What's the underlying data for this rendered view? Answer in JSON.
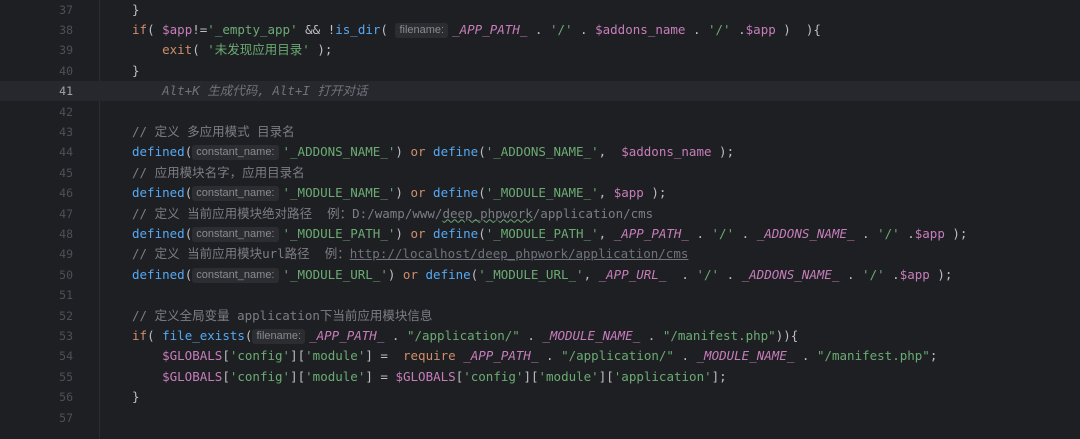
{
  "colors": {
    "background": "#1e1f22",
    "keyword": "#cf8e6d",
    "function": "#56a8f5",
    "string": "#6aab73",
    "variable": "#c77dbb",
    "comment": "#7a7e85",
    "inlay_bg": "#2b2d30"
  },
  "editor": {
    "current_line": 41,
    "lines": [
      {
        "n": "37",
        "tokens": [
          {
            "t": "}",
            "c": "p"
          }
        ]
      },
      {
        "n": "38",
        "tokens": [
          {
            "t": "if",
            "c": "kw"
          },
          {
            "t": "( ",
            "c": "p"
          },
          {
            "t": "$app",
            "c": "var"
          },
          {
            "t": "!=",
            "c": "p"
          },
          {
            "t": "'_empty_app'",
            "c": "str"
          },
          {
            "t": " && !",
            "c": "p"
          },
          {
            "t": "is_dir",
            "c": "fn"
          },
          {
            "t": "( ",
            "c": "p"
          },
          {
            "t": "filename:",
            "c": "inlay"
          },
          {
            "t": "_APP_PATH_",
            "c": "const"
          },
          {
            "t": " . ",
            "c": "p"
          },
          {
            "t": "'/'",
            "c": "str"
          },
          {
            "t": " . ",
            "c": "p"
          },
          {
            "t": "$addons_name",
            "c": "var"
          },
          {
            "t": " . ",
            "c": "p"
          },
          {
            "t": "'/'",
            "c": "str"
          },
          {
            "t": " .",
            "c": "p"
          },
          {
            "t": "$app",
            "c": "var"
          },
          {
            "t": " )  ){",
            "c": "p"
          }
        ]
      },
      {
        "n": "39",
        "tokens": [
          {
            "t": "    ",
            "c": "p"
          },
          {
            "t": "exit",
            "c": "kw"
          },
          {
            "t": "( ",
            "c": "p"
          },
          {
            "t": "'未发现应用目录'",
            "c": "str"
          },
          {
            "t": " );",
            "c": "p"
          }
        ]
      },
      {
        "n": "40",
        "tokens": [
          {
            "t": "}",
            "c": "p"
          }
        ]
      },
      {
        "n": "41",
        "tokens": [
          {
            "t": "    ",
            "c": "p"
          },
          {
            "t": "Alt+K 生成代码, Alt+I 打开对话",
            "c": "hint"
          }
        ]
      },
      {
        "n": "42",
        "tokens": []
      },
      {
        "n": "43",
        "tokens": [
          {
            "t": "// 定义 多应用模式 目录名",
            "c": "cm"
          }
        ]
      },
      {
        "n": "44",
        "tokens": [
          {
            "t": "defined",
            "c": "fn"
          },
          {
            "t": "(",
            "c": "p"
          },
          {
            "t": "constant_name:",
            "c": "inlay"
          },
          {
            "t": "'_ADDONS_NAME_'",
            "c": "str"
          },
          {
            "t": ") ",
            "c": "p"
          },
          {
            "t": "or",
            "c": "kw"
          },
          {
            "t": " ",
            "c": "p"
          },
          {
            "t": "define",
            "c": "fn"
          },
          {
            "t": "(",
            "c": "p"
          },
          {
            "t": "'_ADDONS_NAME_'",
            "c": "str"
          },
          {
            "t": ",  ",
            "c": "p"
          },
          {
            "t": "$addons_name",
            "c": "var"
          },
          {
            "t": " );",
            "c": "p"
          }
        ]
      },
      {
        "n": "45",
        "tokens": [
          {
            "t": "// 应用模块名字，应用目录名",
            "c": "cm"
          }
        ]
      },
      {
        "n": "46",
        "tokens": [
          {
            "t": "defined",
            "c": "fn"
          },
          {
            "t": "(",
            "c": "p"
          },
          {
            "t": "constant_name:",
            "c": "inlay"
          },
          {
            "t": "'_MODULE_NAME_'",
            "c": "str"
          },
          {
            "t": ") ",
            "c": "p"
          },
          {
            "t": "or",
            "c": "kw"
          },
          {
            "t": " ",
            "c": "p"
          },
          {
            "t": "define",
            "c": "fn"
          },
          {
            "t": "(",
            "c": "p"
          },
          {
            "t": "'_MODULE_NAME_'",
            "c": "str"
          },
          {
            "t": ", ",
            "c": "p"
          },
          {
            "t": "$app",
            "c": "var"
          },
          {
            "t": " );",
            "c": "p"
          }
        ]
      },
      {
        "n": "47",
        "tokens": [
          {
            "t": "// 定义 当前应用模块绝对路径  例：D:/wamp/www/",
            "c": "cm"
          },
          {
            "t": "deep_phpwork",
            "c": "cmw"
          },
          {
            "t": "/application/cms",
            "c": "cm"
          }
        ]
      },
      {
        "n": "48",
        "tokens": [
          {
            "t": "defined",
            "c": "fn"
          },
          {
            "t": "(",
            "c": "p"
          },
          {
            "t": "constant_name:",
            "c": "inlay"
          },
          {
            "t": "'_MODULE_PATH_'",
            "c": "str"
          },
          {
            "t": ") ",
            "c": "p"
          },
          {
            "t": "or",
            "c": "kw"
          },
          {
            "t": " ",
            "c": "p"
          },
          {
            "t": "define",
            "c": "fn"
          },
          {
            "t": "(",
            "c": "p"
          },
          {
            "t": "'_MODULE_PATH_'",
            "c": "str"
          },
          {
            "t": ", ",
            "c": "p"
          },
          {
            "t": "_APP_PATH_",
            "c": "const"
          },
          {
            "t": " . ",
            "c": "p"
          },
          {
            "t": "'/'",
            "c": "str"
          },
          {
            "t": " . ",
            "c": "p"
          },
          {
            "t": "_ADDONS_NAME_",
            "c": "const"
          },
          {
            "t": " . ",
            "c": "p"
          },
          {
            "t": "'/'",
            "c": "str"
          },
          {
            "t": " .",
            "c": "p"
          },
          {
            "t": "$app",
            "c": "var"
          },
          {
            "t": " );",
            "c": "p"
          }
        ]
      },
      {
        "n": "49",
        "tokens": [
          {
            "t": "// 定义 当前应用模块url路径  例：",
            "c": "cm"
          },
          {
            "t": "http://localhost/deep_phpwork/application/cms",
            "c": "link"
          }
        ]
      },
      {
        "n": "50",
        "tokens": [
          {
            "t": "defined",
            "c": "fn"
          },
          {
            "t": "(",
            "c": "p"
          },
          {
            "t": "constant_name:",
            "c": "inlay"
          },
          {
            "t": "'_MODULE_URL_'",
            "c": "str"
          },
          {
            "t": ") ",
            "c": "p"
          },
          {
            "t": "or",
            "c": "kw"
          },
          {
            "t": " ",
            "c": "p"
          },
          {
            "t": "define",
            "c": "fn"
          },
          {
            "t": "(",
            "c": "p"
          },
          {
            "t": "'_MODULE_URL_'",
            "c": "str"
          },
          {
            "t": ", ",
            "c": "p"
          },
          {
            "t": "_APP_URL_",
            "c": "const"
          },
          {
            "t": "  . ",
            "c": "p"
          },
          {
            "t": "'/'",
            "c": "str"
          },
          {
            "t": " . ",
            "c": "p"
          },
          {
            "t": "_ADDONS_NAME_",
            "c": "const"
          },
          {
            "t": " . ",
            "c": "p"
          },
          {
            "t": "'/'",
            "c": "str"
          },
          {
            "t": " .",
            "c": "p"
          },
          {
            "t": "$app",
            "c": "var"
          },
          {
            "t": " );",
            "c": "p"
          }
        ]
      },
      {
        "n": "51",
        "tokens": []
      },
      {
        "n": "52",
        "tokens": [
          {
            "t": "// 定义全局变量 application下当前应用模块信息",
            "c": "cm"
          }
        ]
      },
      {
        "n": "53",
        "tokens": [
          {
            "t": "if",
            "c": "kw"
          },
          {
            "t": "( ",
            "c": "p"
          },
          {
            "t": "file_exists",
            "c": "fn"
          },
          {
            "t": "(",
            "c": "p"
          },
          {
            "t": "filename:",
            "c": "inlay"
          },
          {
            "t": "_APP_PATH_",
            "c": "const"
          },
          {
            "t": " . ",
            "c": "p"
          },
          {
            "t": "\"/application/\"",
            "c": "str"
          },
          {
            "t": " . ",
            "c": "p"
          },
          {
            "t": "_MODULE_NAME_",
            "c": "const"
          },
          {
            "t": " . ",
            "c": "p"
          },
          {
            "t": "\"/manifest.php\"",
            "c": "str"
          },
          {
            "t": ")){",
            "c": "p"
          }
        ]
      },
      {
        "n": "54",
        "tokens": [
          {
            "t": "    ",
            "c": "p"
          },
          {
            "t": "$GLOBALS",
            "c": "gv"
          },
          {
            "t": "[",
            "c": "p"
          },
          {
            "t": "'config'",
            "c": "str"
          },
          {
            "t": "][",
            "c": "p"
          },
          {
            "t": "'module'",
            "c": "str"
          },
          {
            "t": "] =  ",
            "c": "p"
          },
          {
            "t": "require",
            "c": "kw"
          },
          {
            "t": " ",
            "c": "p"
          },
          {
            "t": "_APP_PATH_",
            "c": "const"
          },
          {
            "t": " . ",
            "c": "p"
          },
          {
            "t": "\"/application/\"",
            "c": "str"
          },
          {
            "t": " . ",
            "c": "p"
          },
          {
            "t": "_MODULE_NAME_",
            "c": "const"
          },
          {
            "t": " . ",
            "c": "p"
          },
          {
            "t": "\"/manifest.php\"",
            "c": "str"
          },
          {
            "t": ";",
            "c": "p"
          }
        ]
      },
      {
        "n": "55",
        "tokens": [
          {
            "t": "    ",
            "c": "p"
          },
          {
            "t": "$GLOBALS",
            "c": "gv"
          },
          {
            "t": "[",
            "c": "p"
          },
          {
            "t": "'config'",
            "c": "str"
          },
          {
            "t": "][",
            "c": "p"
          },
          {
            "t": "'module'",
            "c": "str"
          },
          {
            "t": "] = ",
            "c": "p"
          },
          {
            "t": "$GLOBALS",
            "c": "gv"
          },
          {
            "t": "[",
            "c": "p"
          },
          {
            "t": "'config'",
            "c": "str"
          },
          {
            "t": "][",
            "c": "p"
          },
          {
            "t": "'module'",
            "c": "str"
          },
          {
            "t": "][",
            "c": "p"
          },
          {
            "t": "'application'",
            "c": "str"
          },
          {
            "t": "];",
            "c": "p"
          }
        ]
      },
      {
        "n": "56",
        "tokens": [
          {
            "t": "}",
            "c": "p"
          }
        ]
      },
      {
        "n": "57",
        "tokens": []
      }
    ]
  }
}
